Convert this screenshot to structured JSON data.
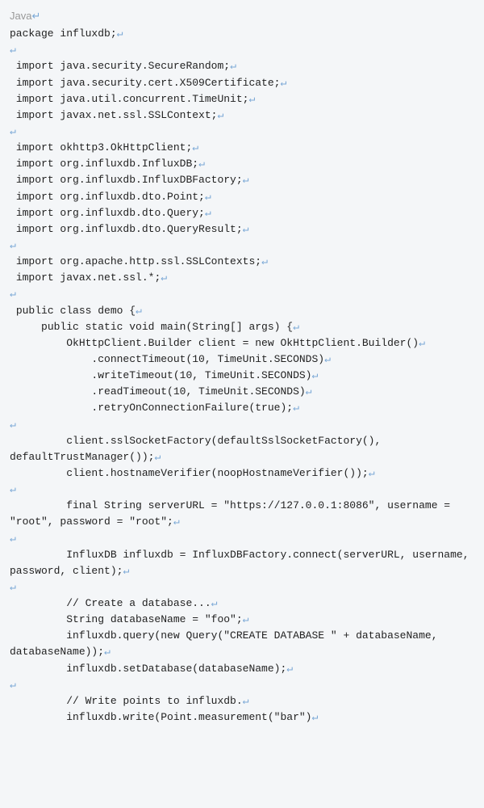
{
  "lang_label": "Java",
  "arrow": "↵",
  "code_lines": [
    {
      "indent": 0,
      "text": "package influxdb;",
      "blank": false
    },
    {
      "indent": 0,
      "text": "",
      "blank": true
    },
    {
      "indent": 0,
      "text": " import java.security.SecureRandom;",
      "blank": false
    },
    {
      "indent": 0,
      "text": " import java.security.cert.X509Certificate;",
      "blank": false
    },
    {
      "indent": 0,
      "text": " import java.util.concurrent.TimeUnit;",
      "blank": false
    },
    {
      "indent": 0,
      "text": " import javax.net.ssl.SSLContext;",
      "blank": false
    },
    {
      "indent": 0,
      "text": "",
      "blank": true
    },
    {
      "indent": 0,
      "text": " import okhttp3.OkHttpClient;",
      "blank": false
    },
    {
      "indent": 0,
      "text": " import org.influxdb.InfluxDB;",
      "blank": false
    },
    {
      "indent": 0,
      "text": " import org.influxdb.InfluxDBFactory;",
      "blank": false
    },
    {
      "indent": 0,
      "text": " import org.influxdb.dto.Point;",
      "blank": false
    },
    {
      "indent": 0,
      "text": " import org.influxdb.dto.Query;",
      "blank": false
    },
    {
      "indent": 0,
      "text": " import org.influxdb.dto.QueryResult;",
      "blank": false
    },
    {
      "indent": 0,
      "text": "",
      "blank": true
    },
    {
      "indent": 0,
      "text": " import org.apache.http.ssl.SSLContexts;",
      "blank": false
    },
    {
      "indent": 0,
      "text": " import javax.net.ssl.*;",
      "blank": false
    },
    {
      "indent": 0,
      "text": "",
      "blank": true
    },
    {
      "indent": 0,
      "text": " public class demo {",
      "blank": false
    },
    {
      "indent": 0,
      "text": "     public static void main(String[] args) {",
      "blank": false
    },
    {
      "indent": 0,
      "text": "         OkHttpClient.Builder client = new OkHttpClient.Builder()",
      "blank": false
    },
    {
      "indent": 0,
      "text": "             .connectTimeout(10, TimeUnit.SECONDS)",
      "blank": false
    },
    {
      "indent": 0,
      "text": "             .writeTimeout(10, TimeUnit.SECONDS)",
      "blank": false
    },
    {
      "indent": 0,
      "text": "             .readTimeout(10, TimeUnit.SECONDS)",
      "blank": false
    },
    {
      "indent": 0,
      "text": "             .retryOnConnectionFailure(true);",
      "blank": false
    },
    {
      "indent": 0,
      "text": "",
      "blank": true
    },
    {
      "indent": 0,
      "text": "         client.sslSocketFactory(defaultSslSocketFactory(), defaultTrustManager());",
      "blank": false
    },
    {
      "indent": 0,
      "text": "         client.hostnameVerifier(noopHostnameVerifier());",
      "blank": false
    },
    {
      "indent": 0,
      "text": "",
      "blank": true
    },
    {
      "indent": 0,
      "text": "         final String serverURL = \"https://127.0.0.1:8086\", username = \"root\", password = \"root\";",
      "blank": false
    },
    {
      "indent": 0,
      "text": "",
      "blank": true
    },
    {
      "indent": 0,
      "text": "         InfluxDB influxdb = InfluxDBFactory.connect(serverURL, username, password, client);",
      "blank": false
    },
    {
      "indent": 0,
      "text": "",
      "blank": true
    },
    {
      "indent": 0,
      "text": "         // Create a database...",
      "blank": false
    },
    {
      "indent": 0,
      "text": "         String databaseName = \"foo\";",
      "blank": false
    },
    {
      "indent": 0,
      "text": "         influxdb.query(new Query(\"CREATE DATABASE \" + databaseName, databaseName));",
      "blank": false
    },
    {
      "indent": 0,
      "text": "         influxdb.setDatabase(databaseName);",
      "blank": false
    },
    {
      "indent": 0,
      "text": "",
      "blank": true
    },
    {
      "indent": 0,
      "text": "         // Write points to influxdb.",
      "blank": false
    },
    {
      "indent": 0,
      "text": "         influxdb.write(Point.measurement(\"bar\")",
      "blank": false
    }
  ]
}
